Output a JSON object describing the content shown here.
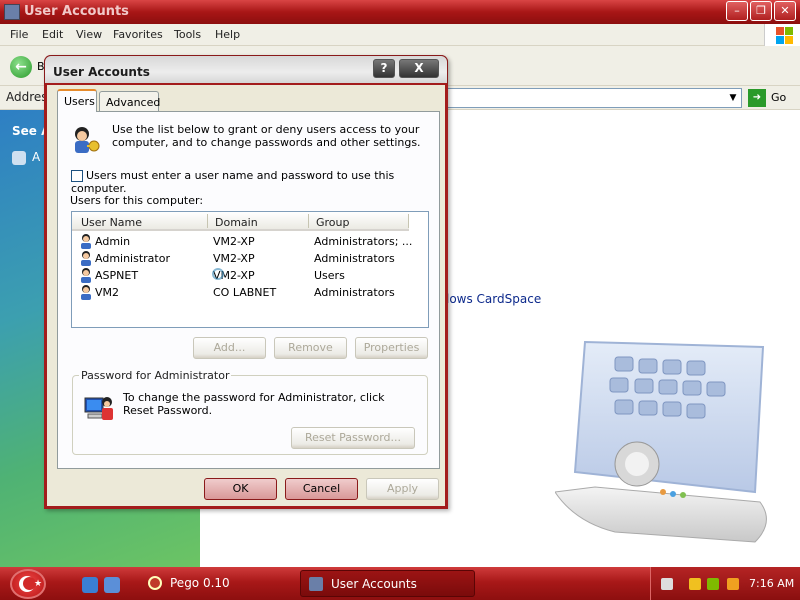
{
  "background_window": {
    "title": "User Accounts",
    "menu": [
      "File",
      "Edit",
      "View",
      "Favorites",
      "Tools",
      "Help"
    ],
    "back_label": "B",
    "address_label": "Addres",
    "go_label": "Go",
    "sidebar_heading": "See A",
    "sidebar_item": "A",
    "cardspace_text": "lows CardSpace"
  },
  "dialog": {
    "title": "User Accounts",
    "help_btn": "?",
    "close_btn": "X",
    "tabs": [
      "Users",
      "Advanced"
    ],
    "active_tab": "Users",
    "intro": "Use the list below to grant or deny users access to your computer, and to change passwords and other settings.",
    "checkbox_label": "Users must enter a user name and password to use this computer.",
    "checkbox_checked": false,
    "users_label": "Users for this computer:",
    "columns": [
      "User Name",
      "Domain",
      "Group"
    ],
    "users": [
      {
        "name": "Admin",
        "domain": "VM2-XP",
        "group": "Administrators; ..."
      },
      {
        "name": "Administrator",
        "domain": "VM2-XP",
        "group": "Administrators"
      },
      {
        "name": "ASPNET",
        "domain": "VM2-XP",
        "group": "Users"
      },
      {
        "name": "VM2",
        "domain": "CO LABNET",
        "group": "Administrators"
      }
    ],
    "buttons": {
      "add": "Add...",
      "remove": "Remove",
      "properties": "Properties"
    },
    "password_group_title": "Password for Administrator",
    "password_text": "To change the password for Administrator, click Reset Password.",
    "reset_button": "Reset Password...",
    "ok": "OK",
    "cancel": "Cancel",
    "apply": "Apply"
  },
  "taskbar": {
    "tasks": [
      {
        "label": "Pego 0.10"
      },
      {
        "label": "User Accounts"
      }
    ],
    "clock": "7:16 AM"
  }
}
